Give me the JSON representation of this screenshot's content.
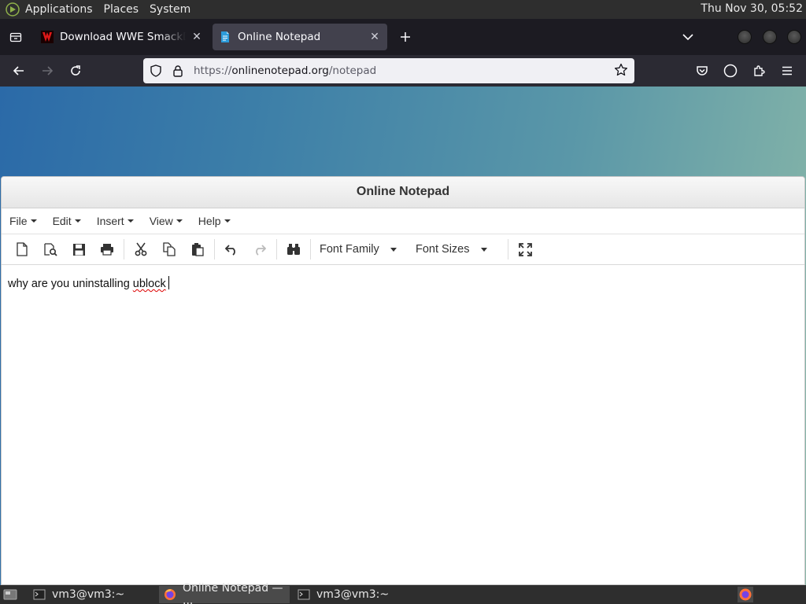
{
  "system_panel": {
    "menus": [
      "Applications",
      "Places",
      "System"
    ],
    "clock": "Thu Nov 30, 05:52"
  },
  "browser": {
    "tabs": [
      {
        "label": "Download WWE SmackDown",
        "active": false,
        "favicon": "red-logo-icon"
      },
      {
        "label": "Online Notepad",
        "active": true,
        "favicon": "notepad-icon"
      }
    ],
    "url": {
      "protocol": "https://",
      "host": "onlinenotepad.org",
      "path": "/notepad"
    }
  },
  "notepad": {
    "title": "Online Notepad",
    "menus": [
      "File",
      "Edit",
      "Insert",
      "View",
      "Help"
    ],
    "font_family_label": "Font Family",
    "font_sizes_label": "Font Sizes",
    "content_prefix": "why are you uninstalling ",
    "content_misspelled": "ublock"
  },
  "taskbar": {
    "tasks": [
      {
        "label": "vm3@vm3:~",
        "active": false
      },
      {
        "label": "Online Notepad — ...",
        "active": true
      },
      {
        "label": "vm3@vm3:~",
        "active": false
      }
    ]
  },
  "colors": {
    "tab_bar": "#1c1b22",
    "active_tab": "#42414d",
    "url_bar": "#f0f0f4",
    "gradient_start": "#2b6aa8",
    "gradient_end": "#8ab8a8"
  }
}
